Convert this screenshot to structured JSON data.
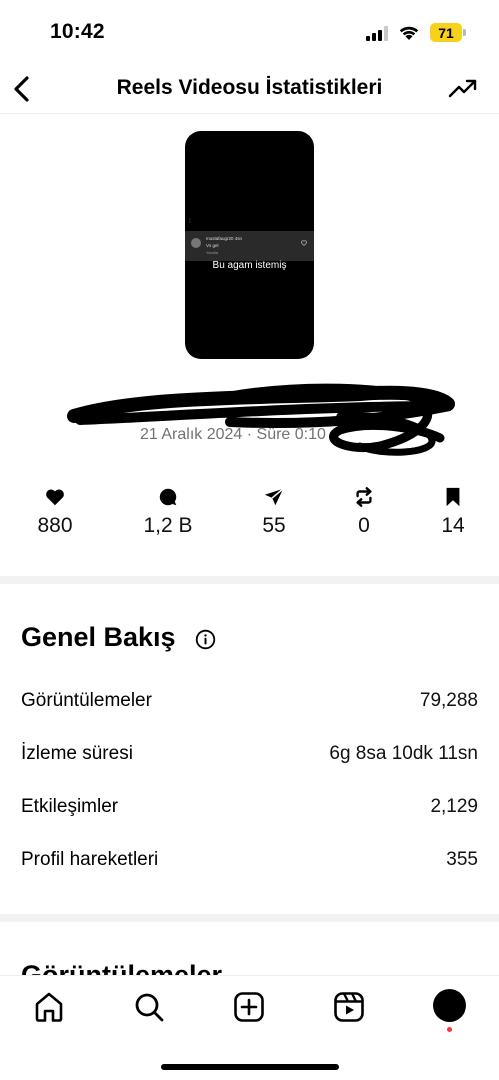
{
  "status_bar": {
    "time": "10:42",
    "battery": "71",
    "battery_color": "#f7d21b"
  },
  "header": {
    "title": "Reels Videosu İstatistikleri",
    "back_icon": "chevron-left-icon",
    "action_icon": "trending-up-icon"
  },
  "reel": {
    "username": "mustafaugr20",
    "username_suffix": "4sn",
    "line2": "Vs gel",
    "line3": "Yanıtla",
    "caption": "Bu agam istemiş"
  },
  "post": {
    "date_line": "21 Aralık 2024 · Süre 0:10"
  },
  "stats": [
    {
      "icon": "heart-icon",
      "value": "880"
    },
    {
      "icon": "comment-icon",
      "value": "1,2 B"
    },
    {
      "icon": "share-icon",
      "value": "55"
    },
    {
      "icon": "repost-icon",
      "value": "0"
    },
    {
      "icon": "bookmark-icon",
      "value": "14"
    }
  ],
  "overview": {
    "title": "Genel Bakış",
    "rows": [
      {
        "label": "Görüntülemeler",
        "value": "79,288"
      },
      {
        "label": "İzleme süresi",
        "value": "6g 8sa 10dk 11sn"
      },
      {
        "label": "Etkileşimler",
        "value": "2,129"
      },
      {
        "label": "Profil hareketleri",
        "value": "355"
      }
    ]
  },
  "next_section": {
    "title": "Görüntülemeler"
  },
  "tab_bar": {
    "items": [
      "home-icon",
      "search-icon",
      "create-icon",
      "reels-icon",
      "profile-avatar"
    ],
    "notification_color": "#ff3040"
  }
}
